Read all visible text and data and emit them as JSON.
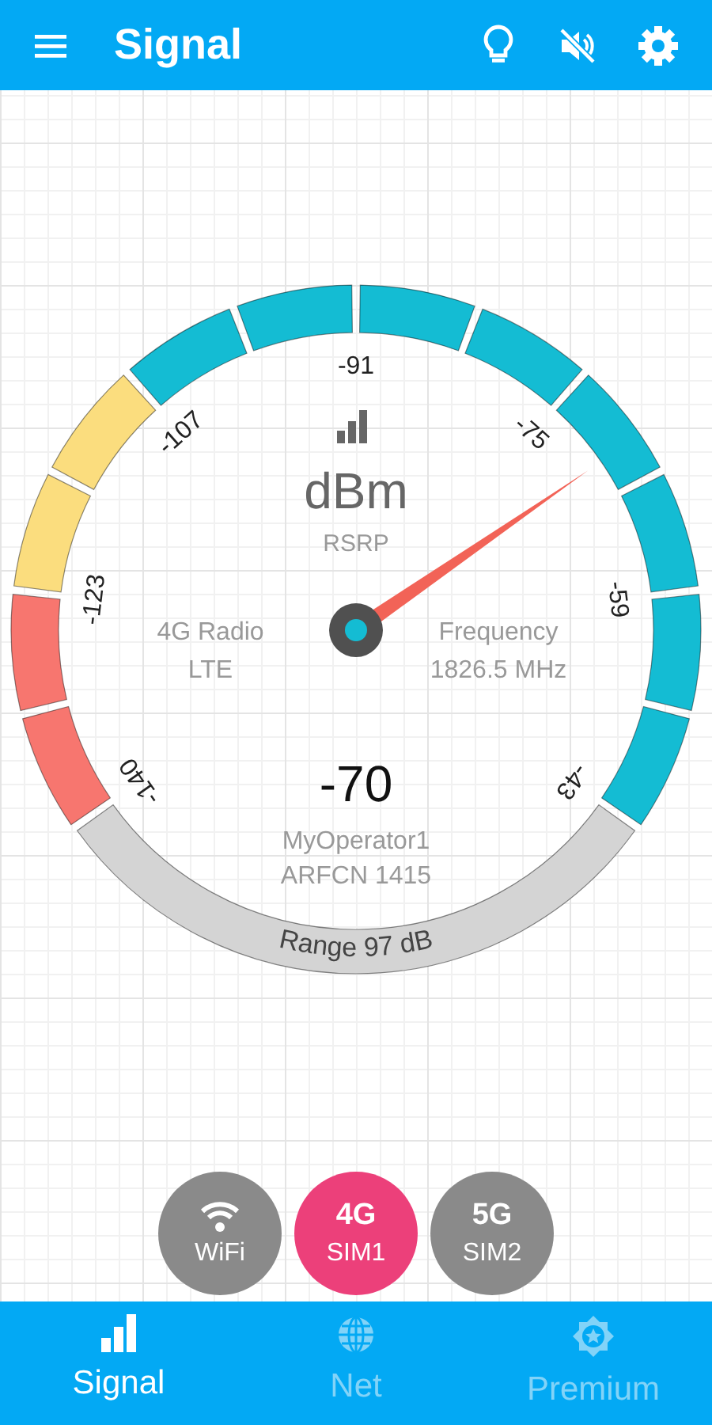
{
  "app_bar": {
    "title": "Signal"
  },
  "gauge": {
    "unit": "dBm",
    "metric": "RSRP",
    "value": "-70",
    "radio_label": "4G Radio",
    "radio_value": "LTE",
    "frequency_label": "Frequency",
    "frequency_value": "1826.5 MHz",
    "operator": "MyOperator1",
    "channel": "ARFCN 1415",
    "range": "Range 97 dB",
    "scale_labels": [
      "-140",
      "-123",
      "-107",
      "-91",
      "-75",
      "-59",
      "-43"
    ],
    "segments": [
      {
        "color": "#f7766f"
      },
      {
        "color": "#f7766f"
      },
      {
        "color": "#fbdd7e"
      },
      {
        "color": "#fbdd7e"
      },
      {
        "color": "#14bcd3"
      },
      {
        "color": "#14bcd3"
      },
      {
        "color": "#14bcd3"
      },
      {
        "color": "#14bcd3"
      },
      {
        "color": "#14bcd3"
      },
      {
        "color": "#14bcd3"
      },
      {
        "color": "#14bcd3"
      },
      {
        "color": "#14bcd3"
      }
    ]
  },
  "network_buttons": [
    {
      "kind": "wifi",
      "label": "WiFi",
      "selected": false
    },
    {
      "kind": "sim",
      "badge": "4G",
      "label": "SIM1",
      "selected": true
    },
    {
      "kind": "sim",
      "badge": "5G",
      "label": "SIM2",
      "selected": false
    }
  ],
  "bottom_nav": [
    {
      "kind": "signal",
      "label": "Signal",
      "selected": true
    },
    {
      "kind": "net",
      "label": "Net",
      "selected": false
    },
    {
      "kind": "premium",
      "label": "Premium",
      "selected": false
    }
  ]
}
